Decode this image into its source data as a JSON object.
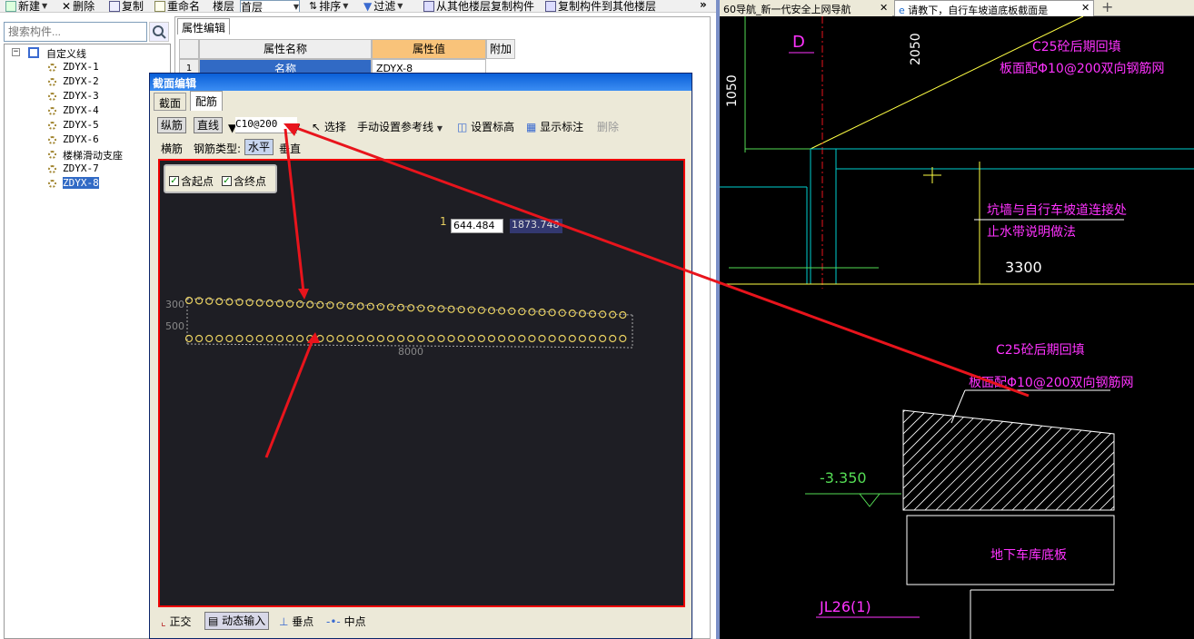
{
  "toolbar": {
    "new": "新建",
    "delete": "删除",
    "copy": "复制",
    "rename": "重命名",
    "floor_label": "楼层",
    "floor_value": "首层",
    "sort": "排序",
    "filter": "过滤",
    "copy_from": "从其他楼层复制构件",
    "copy_to": "复制构件到其他楼层"
  },
  "search": {
    "placeholder": "搜索构件..."
  },
  "tree": {
    "root": "自定义线",
    "items": [
      "ZDYX-1",
      "ZDYX-2",
      "ZDYX-3",
      "ZDYX-4",
      "ZDYX-5",
      "ZDYX-6",
      "楼梯滑动支座",
      "ZDYX-7",
      "ZDYX-8"
    ],
    "selected": "ZDYX-8"
  },
  "property": {
    "tab": "属性编辑",
    "col_name": "属性名称",
    "col_value": "属性值",
    "col_extra": "附加",
    "row1_num": "1",
    "row1_name": "名称",
    "row1_value": "ZDYX-8"
  },
  "dialog": {
    "title": "截面编辑",
    "tabs": [
      "截面",
      "配筋"
    ],
    "active_tab": "配筋",
    "zongjin": "纵筋",
    "line": "直线",
    "spec": "C10@200",
    "select": "选择",
    "manual_ref": "手动设置参考线",
    "set_elev": "设置标高",
    "show_label": "显示标注",
    "delete": "删除",
    "hengjin": "横筋",
    "rebar_type": "钢筋类型:",
    "horizontal": "水平",
    "vertical": "垂直",
    "chk_start": "含起点",
    "chk_end": "含终点",
    "coord_x": "644.484",
    "coord_y": "1873.748",
    "dim_300": "300",
    "dim_500": "500",
    "dim_8000": "8000",
    "status": {
      "ortho": "正交",
      "dynamic": "动态输入",
      "perp": "垂点",
      "mid": "中点"
    }
  },
  "browser": {
    "tab1": "60导航_新一代安全上网导航",
    "tab2": "请教下，自行车坡道底板截面是"
  },
  "cad": {
    "d_label": "D",
    "dim_2050": "2050",
    "dim_1050": "1050",
    "note1_line1": "C25砼后期回填",
    "note1_line2": "板面配Φ10@200双向钢筋网",
    "note2_line1": "坑墙与自行车坡道连接处",
    "note2_line2": "止水带说明做法",
    "dim_3300": "3300",
    "note3_line1": "C25砼后期回填",
    "note3_line2": "板面配Φ10@200双向钢筋网",
    "elev": "-3.350",
    "slab": "地下车库底板",
    "beam": "JL26(1)"
  },
  "colors": {
    "annotation_red": "#e8141c",
    "cad_magenta": "#ff33ff",
    "cad_yellow": "#ffff44",
    "cad_cyan": "#00d0d0",
    "cad_green": "#55dd55"
  }
}
